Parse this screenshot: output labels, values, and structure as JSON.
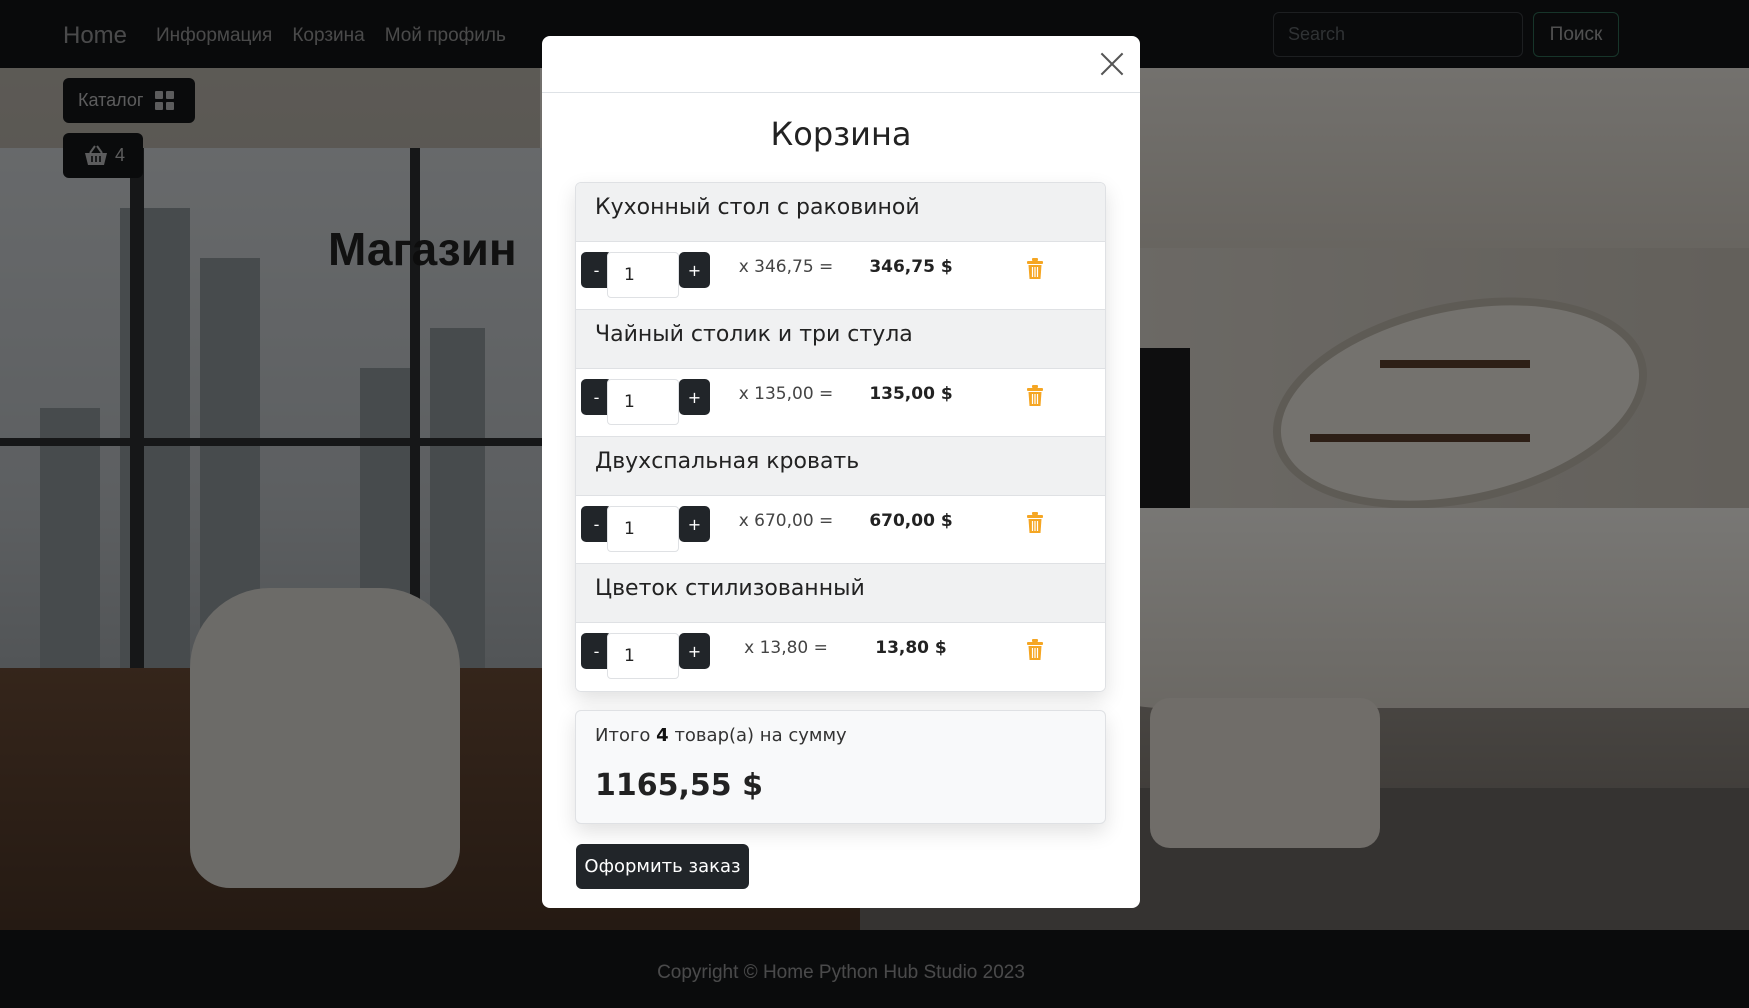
{
  "navbar": {
    "brand": "Home",
    "links": [
      "Информация",
      "Корзина",
      "Мой профиль"
    ],
    "search_placeholder": "Search",
    "search_button": "Поиск"
  },
  "sidebar": {
    "catalog_label": "Каталог",
    "basket_count": "4"
  },
  "hero": {
    "title": "Магазин"
  },
  "cart": {
    "title": "Корзина",
    "items": [
      {
        "name": "Кухонный стол с раковиной",
        "quantity": "1",
        "unit_price": "x 346,75 =",
        "total": "346,75 $"
      },
      {
        "name": "Чайный столик и три стула",
        "quantity": "1",
        "unit_price": "x 135,00 =",
        "total": "135,00 $"
      },
      {
        "name": "Двухспальная кровать",
        "quantity": "1",
        "unit_price": "x 670,00 =",
        "total": "670,00 $"
      },
      {
        "name": "Цветок стилизованный",
        "quantity": "1",
        "unit_price": "x 13,80 =",
        "total": "13,80 $"
      }
    ],
    "minus_label": "-",
    "plus_label": "+",
    "summary": {
      "prefix": "Итого",
      "count": "4",
      "suffix": "товар(а) на сумму",
      "total": "1165,55 $"
    },
    "order_button": "Оформить заказ"
  },
  "footer": {
    "text": "Copyright © Home Python Hub Studio 2023"
  },
  "colors": {
    "trash": "#f5a623",
    "dark": "#212529"
  }
}
